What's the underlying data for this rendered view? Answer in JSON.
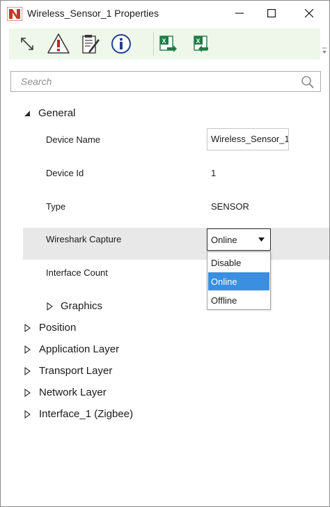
{
  "window": {
    "title": "Wireless_Sensor_1 Properties",
    "logo_icon": "netsim-logo-icon"
  },
  "toolbar": {
    "buttons": [
      {
        "name": "expand-collapse-icon"
      },
      {
        "name": "warning-icon"
      },
      {
        "name": "notes-edit-icon"
      },
      {
        "name": "info-icon"
      },
      {
        "name": "excel-export-icon"
      },
      {
        "name": "excel-import-icon"
      }
    ],
    "accent_color": "#eef7e9"
  },
  "search": {
    "placeholder": "Search",
    "value": ""
  },
  "groups": {
    "general": {
      "label": "General",
      "expanded": true,
      "properties": {
        "device_name": {
          "label": "Device Name",
          "value": "Wireless_Sensor_1"
        },
        "device_id": {
          "label": "Device Id",
          "value": "1"
        },
        "type": {
          "label": "Type",
          "value": "SENSOR"
        },
        "wireshark_capture": {
          "label": "Wireshark Capture",
          "value": "Online"
        },
        "interface_count": {
          "label": "Interface Count",
          "value": ""
        }
      },
      "graphics": {
        "label": "Graphics",
        "expanded": false
      }
    },
    "position": {
      "label": "Position",
      "expanded": false
    },
    "application_layer": {
      "label": "Application Layer",
      "expanded": false
    },
    "transport_layer": {
      "label": "Transport Layer",
      "expanded": false
    },
    "network_layer": {
      "label": "Network Layer",
      "expanded": false
    },
    "interface_1": {
      "label": "Interface_1 (Zigbee)",
      "expanded": false
    }
  },
  "wireshark_dropdown": {
    "open": true,
    "options": [
      "Disable",
      "Online",
      "Offline"
    ],
    "selected": "Online",
    "selected_color": "#3a8fe0"
  }
}
